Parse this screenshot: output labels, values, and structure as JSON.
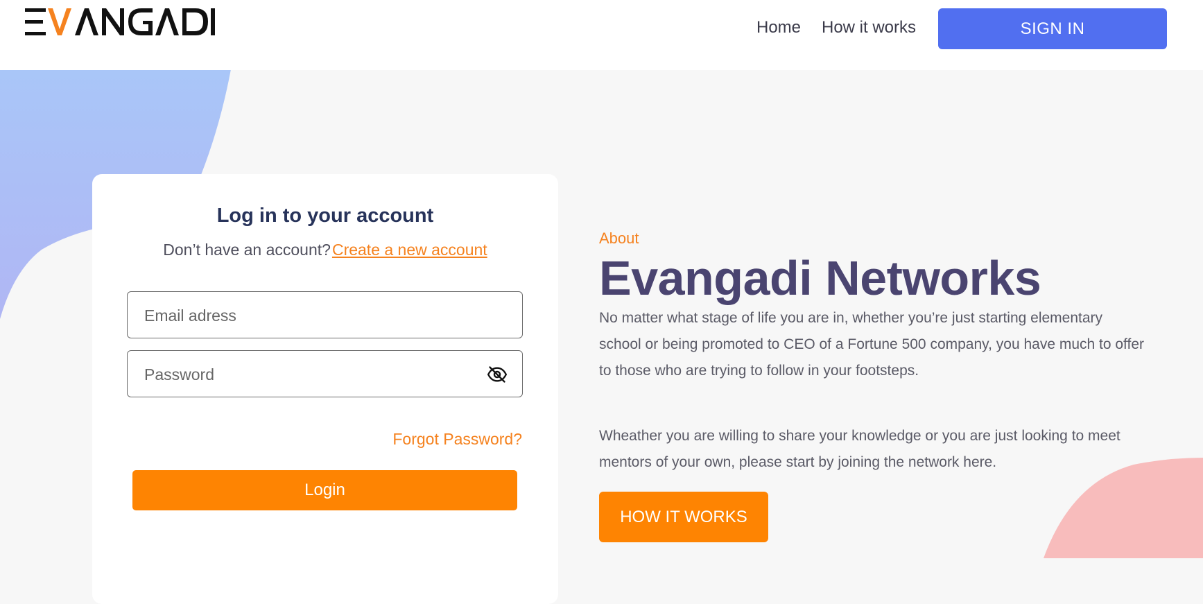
{
  "header": {
    "logo_alt": "EVANGADI",
    "nav": {
      "home": "Home",
      "how_it_works": "How it works"
    },
    "sign_in_label": "SIGN IN"
  },
  "login_card": {
    "title": "Log in to your account",
    "no_account_text": "Don’t have an account?",
    "create_account_link": "Create a new account",
    "email_placeholder": "Email adress",
    "password_placeholder": "Password",
    "forgot_password": "Forgot Password?",
    "login_button": "Login"
  },
  "about": {
    "kicker": "About",
    "title": "Evangadi Networks",
    "paragraph1": "No matter what stage of life you are in, whether you’re just starting elementary school or being promoted to CEO of a Fortune 500 company, you have much to offer to those who are trying to follow in your footsteps.",
    "paragraph2": "Wheather you are willing to share your knowledge or you are just looking to meet mentors of your own, please start by joining the network here.",
    "how_it_works_button": "HOW IT WORKS"
  },
  "colors": {
    "accent_orange": "#fe8402",
    "link_orange": "#f5821f",
    "sign_in_blue": "#516ff0",
    "title_purple": "#4a4470",
    "blob_blue": "#a9c3f7",
    "blob_pink": "#f8bcbc"
  },
  "icons": {
    "password_toggle": "eye-slash-icon"
  }
}
